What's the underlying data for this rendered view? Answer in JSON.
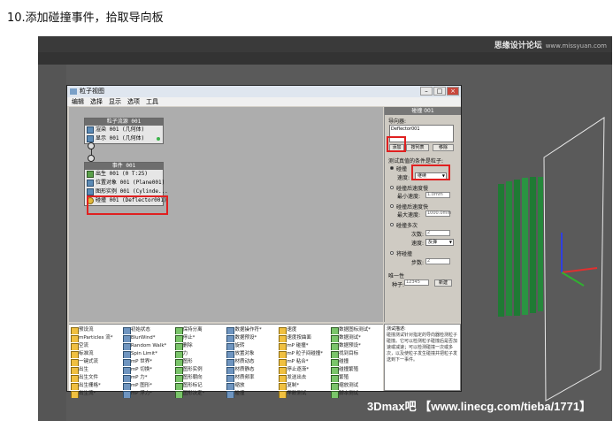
{
  "caption": "10.添加碰撞事件，拾取导向板",
  "watermark_top": "思缘设计论坛",
  "watermark_top_url": "www.missyuan.com",
  "watermark_bottom": "3Dmax吧 【www.linecg.com/tieba/1771】",
  "viewport_label": "视图",
  "particle_view": {
    "title": "粒子视图",
    "menu": [
      "编辑",
      "选择",
      "显示",
      "选项",
      "工具"
    ],
    "window_buttons": [
      "–",
      "□",
      "×"
    ],
    "source_box": {
      "header": "粒子流源 001",
      "rows": [
        "渲染 001 (几何体)",
        "显示 001 (几何体)"
      ]
    },
    "event_box": {
      "header": "事件 001",
      "rows": [
        "出生 001 (0 T:25)",
        "位置对象 001 (Plane001)",
        "图形实例 001 (Cylinde...",
        "碰撞 001 (Deflector001)"
      ]
    },
    "params": {
      "header": "碰撞 001",
      "deflectors_label": "导向器:",
      "deflector_list": [
        "Deflector001"
      ],
      "btn_add": "添加",
      "btn_by_list": "按列表",
      "btn_remove": "移除",
      "test_label": "测试真值的条件是粒子:",
      "opt_collide": "碰撞",
      "speed_label": "速度:",
      "speed_value": "继续",
      "opt_after_speed": "碰撞后速度慢",
      "min_speed_label": "最小速度:",
      "min_speed_value": "1.0mm",
      "opt_after_fast": "碰撞后速度快",
      "max_speed_label": "最大速度:",
      "max_speed_value": "1000.0mm",
      "opt_multi": "碰撞多次",
      "times_label": "次数:",
      "times_value": "2",
      "multi_speed_label": "速度:",
      "multi_speed_value": "反弹",
      "opt_will": "将碰撞",
      "step_label": "步数:",
      "step_value": "2",
      "uniq_label": "唯一性",
      "seed_label": "种子:",
      "seed_value": "12345",
      "new_btn": "新建"
    },
    "depot": [
      [
        "预设流",
        "mParticles 流*",
        "空流",
        "标准流",
        "一键式流",
        "出生",
        "出生文件",
        "出生栅格*",
        "出生流*"
      ],
      [
        "初始状态",
        "BlurWind*",
        "Random Walk*",
        "Spin Limit*",
        "mP 世界*",
        "mP 切换*",
        "mP 力*",
        "mP 图形*",
        "mP 浮力*"
      ],
      [
        "保持分离",
        "停止*",
        "删除",
        "力",
        "图形",
        "图形实例",
        "图形朝向",
        "图形标记",
        "图形决定*"
      ],
      [
        "数据操作符*",
        "数据预设*",
        "旋转",
        "放置对象",
        "材质动态",
        "材质静态",
        "材质频率",
        "缩放",
        "碰撞"
      ],
      [
        "速度",
        "速度按曲面",
        "mP 碰撞*",
        "mP 粒子间碰撞*",
        "mP 粘合*",
        "停止逐渐*",
        "发送出去",
        "复制*",
        "年龄测试"
      ],
      [
        "数据图标测试*",
        "数据测试*",
        "数据预设*",
        "找到目标",
        "碰撞",
        "碰撞繁殖",
        "繁殖",
        "缩放测试",
        "脚本测试"
      ],
      [
        "显示数据*",
        "显示脚本*",
        "注释",
        "缓存",
        "缓存磁盘*",
        "缓存选择*"
      ]
    ],
    "description": {
      "title": "测试描述:",
      "text": "碰撞测试针对指定的导向器检测粒子碰撞。它可以检测粒子碰撞后是否加速或减速；可以检测碰撞一次或多次，以及使粒子发生碰撞并把粒子发送到下一事件。"
    }
  },
  "colors": {
    "highlight": "#e02020",
    "viewport_bg": "#5a5a5a",
    "green_column": "#1f7a34"
  }
}
